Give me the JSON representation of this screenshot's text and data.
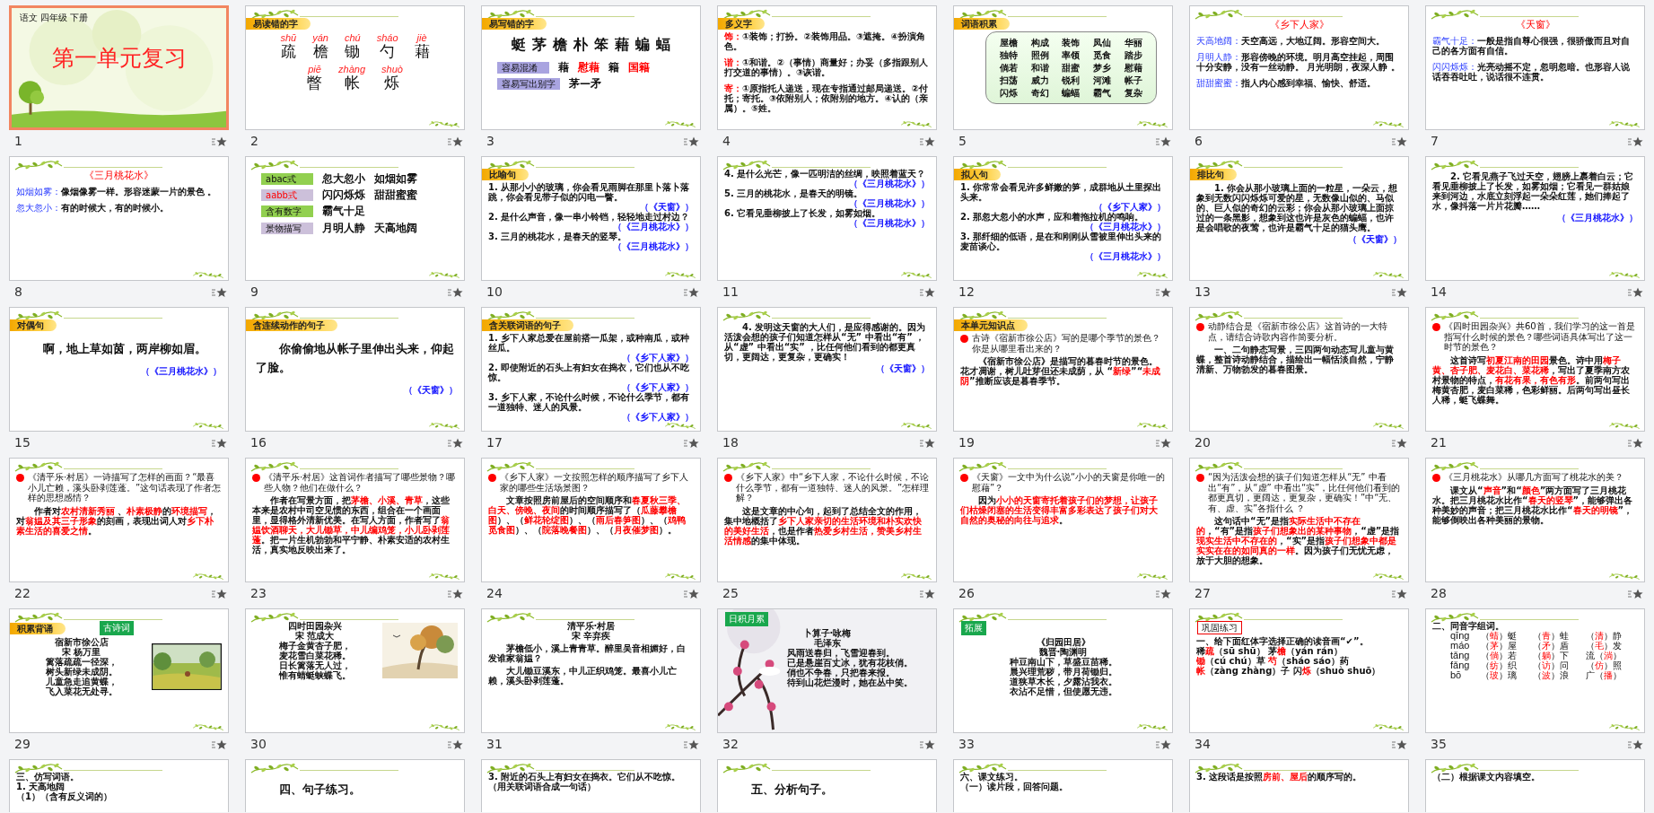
{
  "slides": [
    {
      "number": "1",
      "selected": true,
      "backdrop": {
        "kind": "picture"
      },
      "decor": false,
      "blocks": [
        {
          "kind": "small",
          "text": "语文  四年级  下册"
        },
        {
          "kind": "hero",
          "text": "第一单元复习"
        }
      ]
    },
    {
      "number": "2",
      "selected": false,
      "decor": true,
      "tags": [
        {
          "kind": "banner",
          "text": "易读错的字"
        }
      ],
      "blocks": [
        {
          "kind": "ruby",
          "items": [
            {
              "pinyin": "shū",
              "char": "疏"
            },
            {
              "pinyin": "yán",
              "char": "檐"
            },
            {
              "pinyin": "chú",
              "char": "锄"
            },
            {
              "pinyin": "sháo",
              "char": "勺"
            },
            {
              "pinyin": "jiè",
              "char": "藉"
            }
          ]
        },
        {
          "kind": "ruby",
          "items": [
            {
              "pinyin": "piē",
              "char": "瞥"
            },
            {
              "pinyin": "zhàng",
              "char": "帐"
            },
            {
              "pinyin": "shuò",
              "char": "烁"
            }
          ]
        }
      ]
    },
    {
      "number": "3",
      "selected": false,
      "decor": true,
      "tags": [
        {
          "kind": "banner",
          "text": "易写错的字"
        }
      ],
      "blocks": [
        {
          "kind": "big",
          "items": [
            "蜓",
            "茅",
            "檐",
            "朴",
            "笨",
            "藉",
            "蝙",
            "蝠"
          ]
        },
        {
          "kind": "tagrow",
          "label": "容易混淆",
          "color": "#a9a4e0",
          "label_red": false,
          "words": [
            {
              "text": "藉",
              "red": false
            },
            {
              "text": "慰藉",
              "red": true
            },
            {
              "text": "籍",
              "red": false
            },
            {
              "text": "国籍",
              "red": true
            }
          ]
        },
        {
          "kind": "tagrow",
          "label": "容易写出别字",
          "color": "#a9a4e0",
          "label_red": false,
          "words": [
            {
              "text": "茅—矛",
              "red": false
            }
          ]
        }
      ]
    },
    {
      "number": "4",
      "selected": false,
      "decor": true,
      "tags": [
        {
          "kind": "banner",
          "text": "多义字"
        }
      ],
      "blocks": [
        {
          "kind": "entry",
          "term": "饰：",
          "text": "①装饰；打扮。②装饰用品。③遮掩。④扮演角色。"
        },
        {
          "kind": "entry",
          "term": "谐：",
          "text": "①和谐。②（事情）商量好；办妥（多指跟别人打交道的事情）。③诙谐。"
        },
        {
          "kind": "entry",
          "term": "寄：",
          "text": "①原指托人递送，现在专指通过邮局递送。②付托；寄托。③依附别人；依附别的地方。④认的（亲属）。⑤姓。"
        }
      ]
    },
    {
      "number": "5",
      "selected": false,
      "decor": true,
      "tags": [
        {
          "kind": "banner",
          "text": "词语积累"
        }
      ],
      "blocks": [
        {
          "kind": "words",
          "items": [
            "屋檐",
            "构成",
            "装饰",
            "凤仙",
            "华丽",
            "独特",
            "照例",
            "率领",
            "觅食",
            "踏步",
            "倘若",
            "和谐",
            "甜蜜",
            "梦乡",
            "慰藉",
            "扫荡",
            "威力",
            "锐利",
            "河滩",
            "帐子",
            "闪烁",
            "奇幻",
            "蝙蝠",
            "霸气",
            "复杂"
          ]
        }
      ]
    },
    {
      "number": "6",
      "selected": false,
      "decor": true,
      "blocks": [
        {
          "kind": "title",
          "text": "《乡下人家》"
        },
        {
          "kind": "term",
          "term": "天高地阔：",
          "text": "天空高远，大地辽阔。形容空间大。"
        },
        {
          "kind": "term",
          "term": "月明人静：",
          "text": "形容傍晚的环境。明月高空挂起，周围十分安静，没有一丝动静。 月光明朗，夜深人静 。"
        },
        {
          "kind": "term",
          "term": "甜甜蜜蜜：",
          "text": "指人内心感到幸福、愉快、舒适。"
        }
      ]
    },
    {
      "number": "7",
      "selected": false,
      "decor": true,
      "blocks": [
        {
          "kind": "title",
          "text": "《天窗》"
        },
        {
          "kind": "term",
          "term": "霸气十足：",
          "text": "一般是指自尊心很强，很骄傲而且对自己的各方面有自信。"
        },
        {
          "kind": "term",
          "term": "闪闪烁烁：",
          "text": "光亮动摇不定，忽明忽暗。也形容人说话吞吞吐吐，说话很不连贯。"
        }
      ]
    },
    {
      "number": "8",
      "selected": false,
      "decor": true,
      "blocks": [
        {
          "kind": "title",
          "text": "《三月桃花水》"
        },
        {
          "kind": "term",
          "term": "如烟如雾：",
          "text": "像烟像雾一样。形容迷蒙一片的景色 。"
        },
        {
          "kind": "term",
          "term": "忽大忽小：",
          "text": "有的时候大，有的时候小。"
        }
      ]
    },
    {
      "number": "9",
      "selected": false,
      "decor": true,
      "blocks": [
        {
          "kind": "tagrow",
          "label": "abac式",
          "color": "#92d050",
          "label_red": false,
          "words": [
            {
              "text": "忽大忽小",
              "red": false
            },
            {
              "text": "如烟如雾",
              "red": false
            }
          ]
        },
        {
          "kind": "tagrow",
          "label": "aabb式",
          "color": "#ccc0da",
          "label_red": true,
          "words": [
            {
              "text": "闪闪烁烁",
              "red": false
            },
            {
              "text": "甜甜蜜蜜",
              "red": false
            }
          ]
        },
        {
          "kind": "tagrow",
          "label": "含有数字",
          "color": "#92d050",
          "label_red": false,
          "words": [
            {
              "text": "霸气十足",
              "red": false
            }
          ]
        },
        {
          "kind": "tagrow",
          "label": "景物描写",
          "color": "#ccc0da",
          "label_red": false,
          "words": [
            {
              "text": "月明人静",
              "red": false
            },
            {
              "text": "天高地阔",
              "red": false
            }
          ]
        }
      ]
    },
    {
      "number": "10",
      "selected": false,
      "decor": true,
      "tags": [
        {
          "kind": "banner",
          "text": "比喻句"
        }
      ],
      "blocks": [
        {
          "kind": "text",
          "text": "1. 从那小小的玻璃，你会看见雨脚在那里卜落卜落跳，你会看见带子似的闪电一瞥。"
        },
        {
          "kind": "cite",
          "text": "（《天窗》）"
        },
        {
          "kind": "text",
          "text": "2. 是什么声音，像一串小铃铛，轻轻地走过村边？"
        },
        {
          "kind": "cite",
          "text": "（《三月桃花水》）"
        },
        {
          "kind": "text",
          "text": "3. 三月的桃花水，是春天的竖琴。"
        },
        {
          "kind": "cite",
          "text": "（《三月桃花水》）"
        }
      ]
    },
    {
      "number": "11",
      "selected": false,
      "decor": true,
      "blocks": [
        {
          "kind": "text",
          "text": "4. 是什么光芒，像一匹明洁的丝绸，映照着蓝天？"
        },
        {
          "kind": "cite",
          "text": "（《三月桃花水》）"
        },
        {
          "kind": "text",
          "text": "5. 三月的桃花水，是春天的明镜。"
        },
        {
          "kind": "cite",
          "text": "（《三月桃花水》）"
        },
        {
          "kind": "text",
          "text": "6. 它看见垂柳披上了长发，如雾如烟。"
        },
        {
          "kind": "cite",
          "text": "（《三月桃花水》）"
        }
      ]
    },
    {
      "number": "12",
      "selected": false,
      "decor": true,
      "tags": [
        {
          "kind": "banner",
          "text": "拟人句"
        }
      ],
      "blocks": [
        {
          "kind": "text",
          "text": "1. 你常常会看见许多鲜嫩的笋，成群地从土里探出头来。"
        },
        {
          "kind": "cite",
          "text": "（《乡下人家》）"
        },
        {
          "kind": "text",
          "text": "2. 那忽大忽小的水声，应和着拖拉机的鸣响。"
        },
        {
          "kind": "cite",
          "text": "（《三月桃花水》）"
        },
        {
          "kind": "text",
          "text": "3. 那纤细的低语，是在和刚刚从雪被里伸出头来的麦苗谈心。"
        },
        {
          "kind": "cite",
          "text": "（《三月桃花水》）"
        }
      ]
    },
    {
      "number": "13",
      "selected": false,
      "decor": true,
      "tags": [
        {
          "kind": "banner",
          "text": "排比句"
        }
      ],
      "blocks": [
        {
          "kind": "answer",
          "text": "1. 你会从那小玻璃上面的一粒星，一朵云，想象到无数闪闪烁烁可爱的星，无数像山似的、马似的、巨人似的奇幻的云彩；你会从那小玻璃上面掠过的一条黑影，想象到这也许是灰色的蝙蝠，也许是会唱歌的夜莺，也许是霸气十足的猫头鹰。"
        },
        {
          "kind": "cite",
          "text": "（《天窗》）"
        }
      ]
    },
    {
      "number": "14",
      "selected": false,
      "decor": true,
      "blocks": [
        {
          "kind": "answer",
          "text": "2. 它看见燕子飞过天空，翅膀上裹着白云；它看见垂柳披上了长发，如雾如烟；它看见一群姑娘来到河边，水底立刻浮起一朵朵红莲，她们捧起了水，像抖落一片片花瓣……"
        },
        {
          "kind": "cite",
          "text": "（《三月桃花水》）"
        }
      ]
    },
    {
      "number": "15",
      "selected": false,
      "decor": true,
      "tags": [
        {
          "kind": "banner",
          "text": "对偶句"
        }
      ],
      "blocks": [
        {
          "kind": "lead",
          "text": "啊，地上草如茵，两岸柳如眉。"
        },
        {
          "kind": "cite",
          "text": "（《三月桃花水》）"
        }
      ]
    },
    {
      "number": "16",
      "selected": false,
      "decor": true,
      "tags": [
        {
          "kind": "banner",
          "text": "含连续动作的句子"
        }
      ],
      "blocks": [
        {
          "kind": "lead",
          "text": "你偷偷地从帐子里伸出头来，仰起了脸。"
        },
        {
          "kind": "cite",
          "text": "（《天窗》）"
        }
      ]
    },
    {
      "number": "17",
      "selected": false,
      "decor": true,
      "tags": [
        {
          "kind": "banner",
          "text": "含关联词语的句子"
        }
      ],
      "blocks": [
        {
          "kind": "text",
          "text": "1. 乡下人家总爱在屋前搭一瓜架，或种南瓜，或种丝瓜。"
        },
        {
          "kind": "cite",
          "text": "（《乡下人家》）"
        },
        {
          "kind": "text",
          "text": "2. 即使附近的石头上有妇女在捣衣，它们也从不吃惊。"
        },
        {
          "kind": "cite",
          "text": "（《乡下人家》）"
        },
        {
          "kind": "text",
          "text": "3. 乡下人家，不论什么时候，不论什么季节，都有一道独特、迷人的风景。"
        },
        {
          "kind": "cite",
          "text": "（《乡下人家》）"
        }
      ]
    },
    {
      "number": "18",
      "selected": false,
      "decor": true,
      "blocks": [
        {
          "kind": "answer",
          "text": "4. 发明这天窗的大人们，是应得感谢的。因为活泼会想的孩子们知道怎样从“无” 中看出“有” ，从“虚” 中看出“实” ，比任何他们看到的都更真切，更阔达，更复杂，更确实！"
        },
        {
          "kind": "cite",
          "text": "（《天窗》）"
        }
      ]
    },
    {
      "number": "19",
      "selected": false,
      "decor": true,
      "tags": [
        {
          "kind": "banner",
          "text": "本单元知识点"
        }
      ],
      "blocks": [
        {
          "kind": "question",
          "text": "古诗《宿新市徐公店》写的是哪个季节的景色？你是从哪里看出来的？"
        },
        {
          "kind": "answer",
          "runs": [
            {
              "text": "《宿新市徐公店》是描写的暮春时节的景色。花才凋谢，树儿吐芽但还未成荫，从 “",
              "red": false
            },
            {
              "text": "新绿",
              "red": true
            },
            {
              "text": "”“",
              "red": false
            },
            {
              "text": "未成阴",
              "red": true
            },
            {
              "text": "”推断应该是暮春季节。",
              "red": false
            }
          ]
        }
      ]
    },
    {
      "number": "20",
      "selected": false,
      "decor": true,
      "blocks": [
        {
          "kind": "question",
          "text": "动静结合是《宿新市徐公店》这首诗的一大特点，请结合诗歌内容作简要分析。"
        },
        {
          "kind": "answer",
          "text": "一、二句静态写景，三四两句动态写儿童与黄蝶，整首诗动静结合，描绘出一幅恬淡自然，宁静清新、万物勃发的暮春图景。"
        }
      ]
    },
    {
      "number": "21",
      "selected": false,
      "decor": true,
      "blocks": [
        {
          "kind": "question",
          "text": "《四时田园杂兴》共60首，我们学习的这一首是指写什么时候的景色？哪些词语具体写出了这一时节的景色？"
        },
        {
          "kind": "answer",
          "runs": [
            {
              "text": "这首诗写",
              "red": false
            },
            {
              "text": "初夏江南的田园",
              "red": true
            },
            {
              "text": "景色。诗中用",
              "red": false
            },
            {
              "text": "梅子黄、杏子肥、麦花白、菜花稀",
              "red": true
            },
            {
              "text": "，写出了夏季南方农村景物的特点，",
              "red": false
            },
            {
              "text": "有花有果，有色有形",
              "red": true
            },
            {
              "text": "。前两句写出梅黄杏肥，麦白菜稀，色彩鲜丽。后两句写出昼长人稀，蜓飞蝶舞。",
              "red": false
            }
          ]
        }
      ]
    },
    {
      "number": "22",
      "selected": false,
      "decor": true,
      "blocks": [
        {
          "kind": "question",
          "text": "《清平乐·村居》一诗描写了怎样的画面？“最喜小儿亡赖，溪头卧剥莲蓬。”这句话表现了作者怎样的思想感情？"
        },
        {
          "kind": "answer",
          "runs": [
            {
              "text": "作者对",
              "red": false
            },
            {
              "text": "农村清新秀丽",
              "red": true
            },
            {
              "text": " 、",
              "red": false
            },
            {
              "text": "朴素极静",
              "red": true
            },
            {
              "text": "的",
              "red": false
            },
            {
              "text": "环境描写",
              "red": true
            },
            {
              "text": "，对",
              "red": false
            },
            {
              "text": "翁媪及其三子形象",
              "red": true
            },
            {
              "text": "的刻画，表现出词人对",
              "red": false
            },
            {
              "text": "乡下朴素生活的喜爱之情",
              "red": true
            },
            {
              "text": "。",
              "red": false
            }
          ]
        }
      ]
    },
    {
      "number": "23",
      "selected": false,
      "decor": true,
      "blocks": [
        {
          "kind": "question",
          "text": "《清平乐·村居》这首词作者描写了哪些景物？哪些人物？他们在做什么？"
        },
        {
          "kind": "answer",
          "runs": [
            {
              "text": "作者在写景方面，把",
              "red": false
            },
            {
              "text": "茅檐、小溪、青草",
              "red": true
            },
            {
              "text": "，这些本来是农村中司空见惯的东西，组合在一个画面里，显得格外清新优美。在写人方面，作者写了",
              "red": false
            },
            {
              "text": "翁媪饮酒聊天，大儿锄草，中儿编鸡笼，小儿卧剥莲蓬",
              "red": true
            },
            {
              "text": "。把一片生机勃勃和平宁静、朴素安适的农村生活，真实地反映出来了。",
              "red": false
            }
          ]
        }
      ]
    },
    {
      "number": "24",
      "selected": false,
      "decor": true,
      "blocks": [
        {
          "kind": "question",
          "text": "《乡下人家》一文按照怎样的顺序描写了乡下人家的哪些生活场景图？"
        },
        {
          "kind": "answer",
          "runs": [
            {
              "text": "文章按照房前屋后的空间顺序和",
              "red": false
            },
            {
              "text": "春夏秋三季、白天、傍晚、夜间",
              "red": true
            },
            {
              "text": "的时间顺序描写了（",
              "red": false
            },
            {
              "text": "瓜藤攀檐图",
              "red": true
            },
            {
              "text": "）、（",
              "red": false
            },
            {
              "text": "鲜花轮绽图",
              "red": true
            },
            {
              "text": "）、（",
              "red": false
            },
            {
              "text": "雨后春笋图",
              "red": true
            },
            {
              "text": "）、（",
              "red": false
            },
            {
              "text": "鸡鸭觅食图",
              "red": true
            },
            {
              "text": "）、（",
              "red": false
            },
            {
              "text": "院落晚餐图",
              "red": true
            },
            {
              "text": "）、（",
              "red": false
            },
            {
              "text": "月夜催梦图",
              "red": true
            },
            {
              "text": "）。",
              "red": false
            }
          ]
        }
      ]
    },
    {
      "number": "25",
      "selected": false,
      "decor": true,
      "blocks": [
        {
          "kind": "question",
          "text": "《乡下人家》中“乡下人家，不论什么时候，不论什么季节，都有一道独特、迷人的风景。”怎样理解？"
        },
        {
          "kind": "answer",
          "runs": [
            {
              "text": "这是文章的中心句，起到了总结全文的作用，集中地概括了",
              "red": false
            },
            {
              "text": "乡下人家亲切的生活环境和朴实欢快的美好生活",
              "red": true
            },
            {
              "text": "，也是作者",
              "red": false
            },
            {
              "text": "热爱乡村生活，赞美乡村生活情感",
              "red": true
            },
            {
              "text": "的集中体现。",
              "red": false
            }
          ]
        }
      ]
    },
    {
      "number": "26",
      "selected": false,
      "decor": true,
      "blocks": [
        {
          "kind": "question",
          "text": "《天窗》一文中为什么说“小小的天窗是你唯一的慰藉”？"
        },
        {
          "kind": "answer",
          "runs": [
            {
              "text": "因为",
              "red": false
            },
            {
              "text": "小小的天窗寄托着孩子们的梦想，让孩子们枯燥闭塞的生活变得丰富多彩表达了孩子们对大自然的奥秘的向往与追求",
              "red": true
            },
            {
              "text": "。",
              "red": false
            }
          ]
        }
      ]
    },
    {
      "number": "27",
      "selected": false,
      "decor": true,
      "blocks": [
        {
          "kind": "question",
          "text": "“因为活泼会想的孩子们知道怎样从“无” 中看出“有”，从“虚” 中看出“实”，比任何他们看到的都更真切，更阔达，更复杂，更确实！”中“无、有、虚、实”各指什么 ？"
        },
        {
          "kind": "answer",
          "runs": [
            {
              "text": "这句话中“无”是指",
              "red": false
            },
            {
              "text": "实际生活中不存在的",
              "red": true
            },
            {
              "text": "，“有”是指",
              "red": false
            },
            {
              "text": "孩子们想象出的某种事物",
              "red": true
            },
            {
              "text": "，“虚”是指",
              "red": false
            },
            {
              "text": "现实生活中不存在的",
              "red": true
            },
            {
              "text": "，“实”是指",
              "red": false
            },
            {
              "text": "孩子们想象中都是实实在在的如同真的一样",
              "red": true
            },
            {
              "text": "。因为孩子们无忧无虑，放于大胆的想象。",
              "red": false
            }
          ]
        }
      ]
    },
    {
      "number": "28",
      "selected": false,
      "decor": true,
      "blocks": [
        {
          "kind": "question",
          "text": "《三月桃花水》从哪几方面写了桃花水的美？"
        },
        {
          "kind": "answer",
          "runs": [
            {
              "text": "课文从“",
              "red": false
            },
            {
              "text": "声音",
              "red": true
            },
            {
              "text": "”和“",
              "red": false
            },
            {
              "text": "颜色",
              "red": true
            },
            {
              "text": "”两方面写了三月桃花水。把三月桃花水比作“",
              "red": false
            },
            {
              "text": "春天的竖琴",
              "red": true
            },
            {
              "text": "”，能够弹出各种美妙的声音；把三月桃花水比作“",
              "red": false
            },
            {
              "text": "春天的明镜",
              "red": true
            },
            {
              "text": "”，能够倒映出各种美丽的景物。",
              "red": false
            }
          ]
        }
      ]
    },
    {
      "number": "29",
      "selected": false,
      "decor": true,
      "tags": [
        {
          "kind": "banner",
          "text": "积累背诵"
        },
        {
          "kind": "green",
          "text": "古诗词"
        }
      ],
      "side": {
        "kind": "picture"
      },
      "blocks": [
        {
          "kind": "poem",
          "lines": [
            "宿新市徐公店",
            "宋 杨万里",
            "篱落疏疏一径深，",
            "树头新绿未成阴。",
            "儿童急走追黄蝶，",
            "飞入菜花无处寻。"
          ]
        }
      ]
    },
    {
      "number": "30",
      "selected": false,
      "decor": true,
      "side": {
        "kind": "picture"
      },
      "blocks": [
        {
          "kind": "poem",
          "lines": [
            "四时田园杂兴",
            "宋  范成大",
            "梅子金黄杏子肥，",
            "麦花雪白菜花稀。",
            "日长篱落无人过，",
            "惟有蜻蜓蛱蝶飞。"
          ]
        }
      ]
    },
    {
      "number": "31",
      "selected": false,
      "decor": true,
      "blocks": [
        {
          "kind": "poem",
          "lines": [
            "清平乐·村居",
            "宋   辛弃疾"
          ]
        },
        {
          "kind": "answer",
          "text": "茅檐低小，溪上青青草。醉里吴音相媚好，白发谁家翁媪？"
        },
        {
          "kind": "answer",
          "text": "大儿锄豆溪东，中儿正织鸡笼。最喜小儿亡赖，溪头卧剥莲蓬。"
        }
      ]
    },
    {
      "number": "32",
      "selected": false,
      "backdrop": {
        "kind": "picture"
      },
      "decor": false,
      "tags": [
        {
          "kind": "green",
          "text": "日积月累"
        }
      ],
      "blocks": [
        {
          "kind": "poem",
          "lines": [
            "卜算子·咏梅",
            "毛泽东"
          ]
        },
        {
          "kind": "verse",
          "lines": [
            "风雨送春归，飞雪迎春到。",
            "已是悬崖百丈冰，犹有花枝俏。",
            "俏也不争春，只把春来报。",
            "待到山花烂漫时，她在丛中笑。"
          ]
        }
      ]
    },
    {
      "number": "33",
      "selected": false,
      "decor": true,
      "tags": [
        {
          "kind": "green",
          "text": "拓展"
        }
      ],
      "blocks": [
        {
          "kind": "poem",
          "lines": [
            "《归园田居》",
            "魏晋·陶渊明",
            "种豆南山下，草盛豆苗稀。",
            "晨兴理荒秽，带月荷锄归。",
            "道狭草木长，夕露沾我衣。",
            "衣沾不足惜，但使愿无违。"
          ]
        }
      ]
    },
    {
      "number": "34",
      "selected": false,
      "decor": true,
      "tags": [
        {
          "kind": "outline",
          "text": "巩固练习"
        }
      ],
      "blocks": [
        {
          "kind": "text",
          "text": "一、给下面红体字选择正确的读音画“✔”。"
        },
        {
          "kind": "text",
          "runs": [
            {
              "text": "稀",
              "red": false
            },
            {
              "text": "疏",
              "red": true
            },
            {
              "text": "（sū shū）  茅",
              "red": false
            },
            {
              "text": "檐",
              "red": true
            },
            {
              "text": "（yán rán）",
              "red": false
            }
          ]
        },
        {
          "kind": "text",
          "runs": [
            {
              "text": "锄",
              "red": true
            },
            {
              "text": "（cú chú）草  ",
              "red": false
            },
            {
              "text": "芍",
              "red": true
            },
            {
              "text": "（sháo sáo）药",
              "red": false
            }
          ]
        },
        {
          "kind": "text",
          "runs": [
            {
              "text": "帐",
              "red": true
            },
            {
              "text": "（zàng zhàng）子  闪",
              "red": false
            },
            {
              "text": "烁",
              "red": true
            },
            {
              "text": "（shuò shuō）",
              "red": false
            }
          ]
        }
      ]
    },
    {
      "number": "35",
      "selected": false,
      "decor": true,
      "blocks": [
        {
          "kind": "text",
          "text": "二、同音字组词。"
        },
        {
          "kind": "trow",
          "pinyin": "qīng",
          "cells": [
            {
              "pre": "（",
              "answer": "蜻",
              "post": "）蜓"
            },
            {
              "pre": "（",
              "answer": "青",
              "post": "）蛙"
            },
            {
              "pre": "（",
              "answer": "清",
              "post": "）静"
            }
          ]
        },
        {
          "kind": "trow",
          "pinyin": "máo",
          "cells": [
            {
              "pre": "（",
              "answer": "茅",
              "post": "）屋"
            },
            {
              "pre": "（",
              "answer": "矛",
              "post": "）盾"
            },
            {
              "pre": "（",
              "answer": "毛",
              "post": "）发"
            }
          ]
        },
        {
          "kind": "trow",
          "pinyin": "tǎng",
          "cells": [
            {
              "pre": "（",
              "answer": "倘",
              "post": "）若"
            },
            {
              "pre": "（",
              "answer": "躺",
              "post": "）下"
            },
            {
              "pre": "流（",
              "answer": "淌",
              "post": "）"
            }
          ]
        },
        {
          "kind": "trow",
          "pinyin": "fǎng",
          "cells": [
            {
              "pre": "（",
              "answer": "纺",
              "post": "）织"
            },
            {
              "pre": "（",
              "answer": "访",
              "post": "）问"
            },
            {
              "pre": "（",
              "answer": "仿",
              "post": "）照"
            }
          ]
        },
        {
          "kind": "trow",
          "pinyin": "bō",
          "cells": [
            {
              "pre": "（",
              "answer": "玻",
              "post": "）璃"
            },
            {
              "pre": "（",
              "answer": "波",
              "post": "）浪"
            },
            {
              "pre": "广（",
              "answer": "播",
              "post": "）"
            }
          ]
        }
      ]
    },
    {
      "selected": false,
      "decor": true,
      "blocks": [
        {
          "kind": "text",
          "text": "三、仿写词语。"
        },
        {
          "kind": "text",
          "text": "1. 天高地阔"
        },
        {
          "kind": "text",
          "text": "（1）（含有反义词的）"
        }
      ]
    },
    {
      "selected": false,
      "decor": true,
      "blocks": [
        {
          "kind": "lead",
          "text": "四、句子练习。"
        }
      ]
    },
    {
      "selected": false,
      "decor": true,
      "blocks": [
        {
          "kind": "text",
          "text": "3. 附近的石头上有妇女在捣衣。它们从不吃惊。（用关联词语合成一句话）"
        }
      ]
    },
    {
      "selected": false,
      "decor": true,
      "blocks": [
        {
          "kind": "lead",
          "text": "五、分析句子。"
        }
      ]
    },
    {
      "selected": false,
      "decor": true,
      "blocks": [
        {
          "kind": "text",
          "text": "六、课文练习。"
        },
        {
          "kind": "text",
          "text": "（一）读片段，回答问题。"
        }
      ]
    },
    {
      "selected": false,
      "decor": true,
      "blocks": [
        {
          "kind": "text",
          "runs": [
            {
              "text": "3. 这段话是按照",
              "red": false
            },
            {
              "text": "房前、屋后",
              "red": true
            },
            {
              "text": "的顺序写的。",
              "red": false
            }
          ]
        }
      ]
    },
    {
      "selected": false,
      "decor": true,
      "blocks": [
        {
          "kind": "text",
          "text": "（二）根据课文内容填空。"
        }
      ]
    }
  ]
}
